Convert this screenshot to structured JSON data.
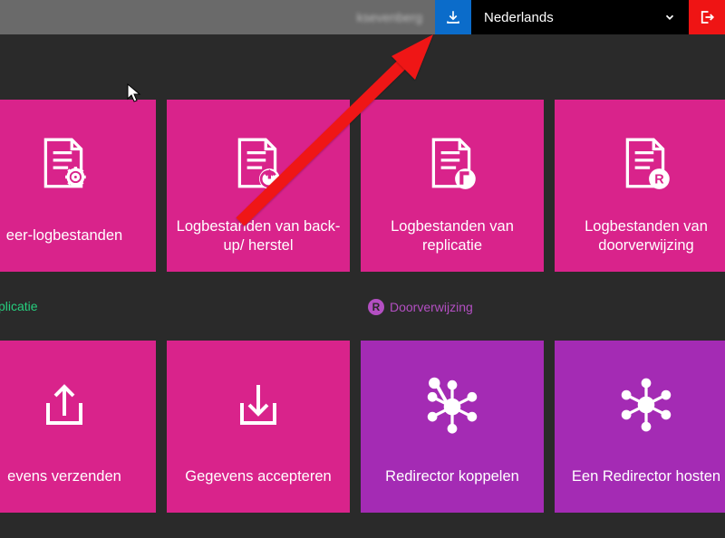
{
  "header": {
    "username": "ksevenberg",
    "download_icon": "download-icon",
    "language_selected": "Nederlands",
    "logout_icon": "logout-icon"
  },
  "sections": {
    "replication_label": "plicatie",
    "redirect_label": "Doorverwijzing",
    "redirect_badge": "R"
  },
  "tiles_row1": [
    {
      "label": "eer-logbestanden",
      "icon": "file-gear"
    },
    {
      "label": "Logbestanden van back-up/ herstel",
      "icon": "file-restore"
    },
    {
      "label": "Logbestanden van replicatie",
      "icon": "file-replicate"
    },
    {
      "label": "Logbestanden van doorverwijzing",
      "icon": "file-redirect"
    }
  ],
  "tiles_row2": [
    {
      "label": "evens verzenden",
      "icon": "send-up"
    },
    {
      "label": "Gegevens accepteren",
      "icon": "receive-down"
    },
    {
      "label": "Redirector koppelen",
      "icon": "network-link"
    },
    {
      "label": "Een Redirector hosten",
      "icon": "network-host"
    }
  ],
  "colors": {
    "pink": "#d9238b",
    "purple": "#a42bb4",
    "header_blue": "#0b6cca",
    "header_red": "#ef1414",
    "header_grey": "#6a6a6a",
    "bg": "#2a2a2a",
    "section_green": "#26cf7e",
    "section_purple": "#b34fc2"
  }
}
